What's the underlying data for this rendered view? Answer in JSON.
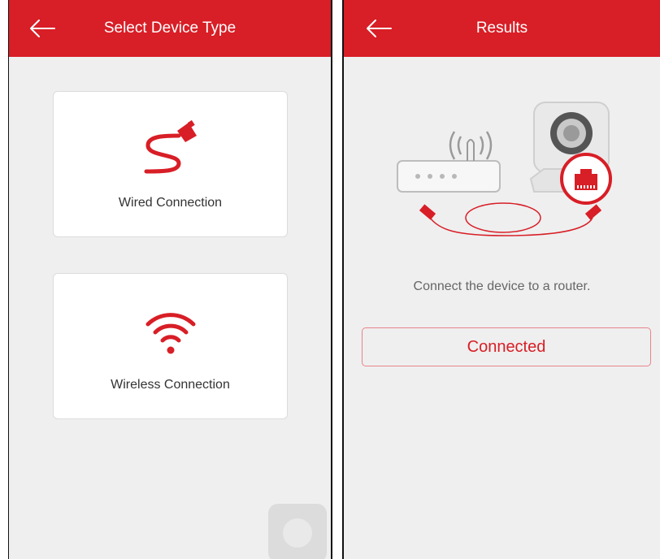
{
  "left": {
    "title": "Select Device Type",
    "options": [
      {
        "label": "Wired Connection",
        "icon": "ethernet-cable-icon"
      },
      {
        "label": "Wireless Connection",
        "icon": "wifi-icon"
      }
    ]
  },
  "right": {
    "title": "Results",
    "hint": "Connect the device to a router.",
    "button_label": "Connected",
    "illustration": "router-camera-cable-illustration"
  },
  "colors": {
    "brand": "#d81e26",
    "background": "#efefef",
    "card": "#ffffff",
    "text": "#333333"
  }
}
